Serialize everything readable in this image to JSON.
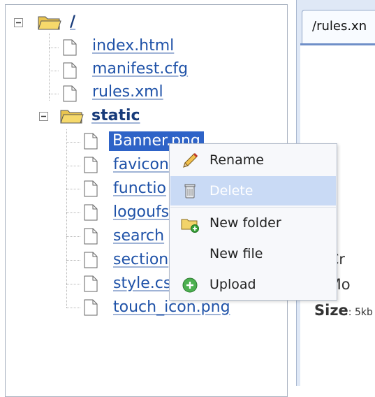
{
  "tree": {
    "root": {
      "label": "/"
    },
    "files": [
      {
        "label": "index.html"
      },
      {
        "label": "manifest.cfg"
      },
      {
        "label": "rules.xml"
      }
    ],
    "folder": {
      "label": "static",
      "children": [
        {
          "label": "Banner.png"
        },
        {
          "label": "favicon"
        },
        {
          "label": "functio"
        },
        {
          "label": "logoufs"
        },
        {
          "label": "search"
        },
        {
          "label": "section"
        },
        {
          "label": "style.cs"
        },
        {
          "label": "touch_icon.png"
        }
      ]
    }
  },
  "context_menu": {
    "items": [
      {
        "label": "Rename",
        "icon": "pencil-icon"
      },
      {
        "label": "Delete",
        "icon": "trash-icon"
      },
      {
        "label": "New folder",
        "icon": "folder-add-icon"
      },
      {
        "label": "New file",
        "icon": ""
      },
      {
        "label": "Upload",
        "icon": "upload-icon"
      }
    ]
  },
  "editor": {
    "tab_label": "/rules.xn",
    "properties": {
      "created_partial": "e Cr",
      "modified_partial": "e Mo",
      "size_label": "Size",
      "size_value": ": 5kb"
    }
  },
  "colors": {
    "selection": "#2e63c7",
    "link": "#1f52a8",
    "menu_highlight": "#c9daf5",
    "panel_bg": "#dfe8f6"
  }
}
